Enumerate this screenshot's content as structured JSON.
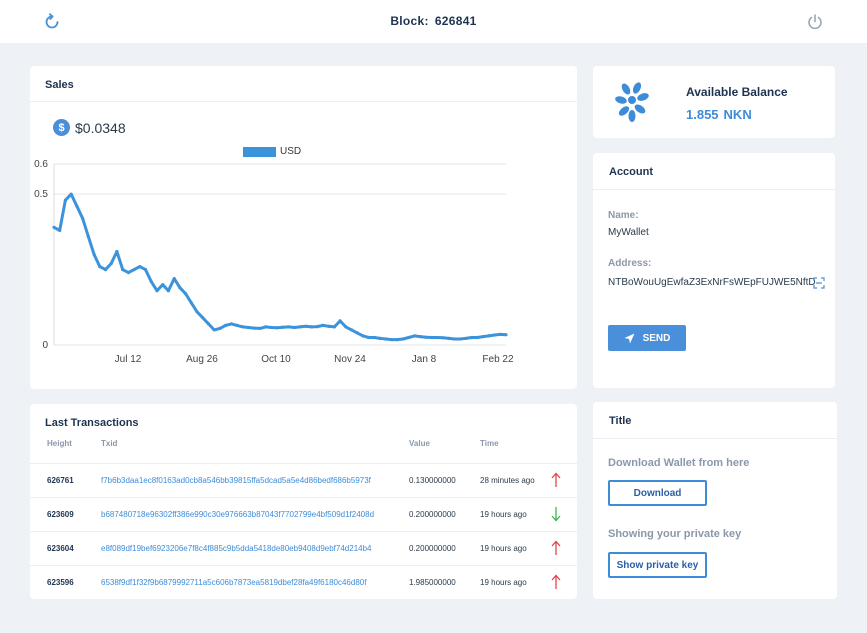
{
  "header": {
    "block_label": "Block:",
    "block_number": "626841"
  },
  "sales": {
    "title": "Sales",
    "currency_icon": "dollar-icon",
    "price": "$0.0348",
    "legend": "USD",
    "series_color": "#3b93dc"
  },
  "chart_data": {
    "type": "line",
    "title": "",
    "xlabel": "",
    "ylabel": "",
    "ylim": [
      0,
      0.6
    ],
    "y_ticks": [
      "0",
      "0.5",
      "0.6"
    ],
    "x_ticks": [
      "Jul 12",
      "Aug 26",
      "Oct 10",
      "Nov 24",
      "Jan 8",
      "Feb 22"
    ],
    "legend_position": "top-center",
    "series": [
      {
        "name": "USD",
        "values": [
          0.39,
          0.38,
          0.48,
          0.5,
          0.46,
          0.42,
          0.36,
          0.3,
          0.26,
          0.25,
          0.27,
          0.31,
          0.25,
          0.24,
          0.25,
          0.26,
          0.25,
          0.21,
          0.18,
          0.2,
          0.18,
          0.22,
          0.19,
          0.17,
          0.14,
          0.11,
          0.09,
          0.07,
          0.05,
          0.055,
          0.065,
          0.07,
          0.065,
          0.06,
          0.058,
          0.056,
          0.055,
          0.06,
          0.058,
          0.057,
          0.059,
          0.06,
          0.058,
          0.06,
          0.062,
          0.06,
          0.061,
          0.065,
          0.062,
          0.06,
          0.08,
          0.06,
          0.05,
          0.04,
          0.03,
          0.025,
          0.025,
          0.022,
          0.02,
          0.018,
          0.018,
          0.02,
          0.025,
          0.03,
          0.028,
          0.026,
          0.025,
          0.025,
          0.024,
          0.022,
          0.02,
          0.02,
          0.022,
          0.025,
          0.025,
          0.028,
          0.03,
          0.033,
          0.035,
          0.034
        ]
      }
    ]
  },
  "balance": {
    "icon": "nkn-logo",
    "label": "Available Balance",
    "amount": "1.855",
    "unit": "NKN"
  },
  "account": {
    "title": "Account",
    "name_label": "Name:",
    "name_value": "MyWallet",
    "address_label": "Address:",
    "address_value": "NTBoWouUgEwfaZ3ExNrFsWEpFUJWE5NftD",
    "send_label": "SEND"
  },
  "transactions": {
    "title": "Last Transactions",
    "columns": [
      "Height",
      "Txid",
      "Value",
      "Time"
    ],
    "rows": [
      {
        "height": "626761",
        "txid": "f7b6b3daa1ec8f0163ad0cb8a546bb39815ffa5dcad5a5e4d86bedf686b5973f",
        "value": "0.130000000",
        "time": "28 minutes ago",
        "direction": "out"
      },
      {
        "height": "623609",
        "txid": "b687480718e96302ff386e990c30e976663b87043f7702799e4bf509d1f2408d",
        "value": "0.200000000",
        "time": "19 hours ago",
        "direction": "in"
      },
      {
        "height": "623604",
        "txid": "e8f089df19bef6923206e7f8c4f885c9b5dda5418de80eb9408d9ebf74d214b4",
        "value": "0.200000000",
        "time": "19 hours ago",
        "direction": "out"
      },
      {
        "height": "623596",
        "txid": "6538f9df1f32f9b6879992711a5c606b7873ea5819dbef28fa49f6180c46d80f",
        "value": "1.985000000",
        "time": "19 hours ago",
        "direction": "out"
      }
    ],
    "out_color": "#e0454b",
    "in_color": "#3cb54a"
  },
  "title_card": {
    "title": "Title",
    "download_label": "Download Wallet from here",
    "download_button": "Download",
    "private_key_label": "Showing your private key",
    "private_key_button": "Show private key"
  }
}
